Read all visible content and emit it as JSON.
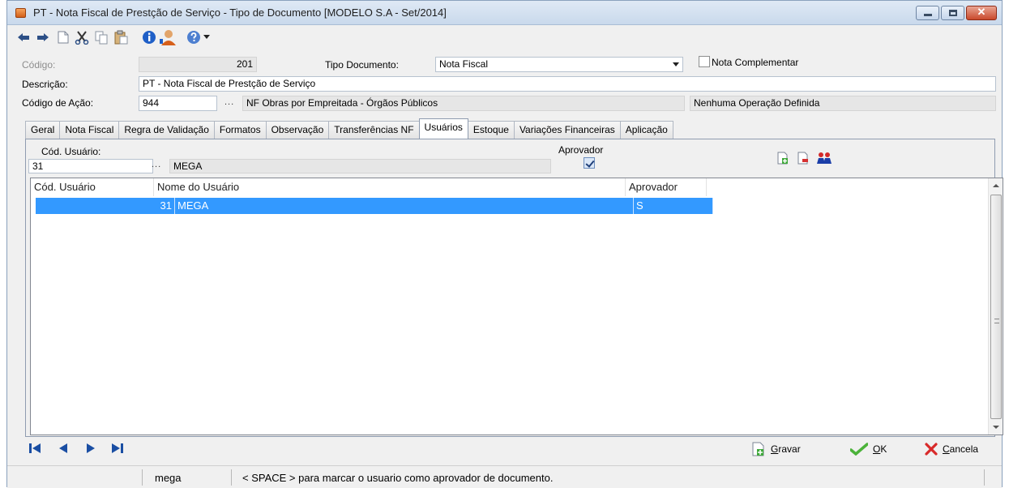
{
  "window": {
    "title": "PT - Nota Fiscal de Prestção de Serviço -  Tipo de Documento [MODELO S.A - Set/2014]",
    "buttons": [
      "minimize",
      "maximize",
      "close"
    ]
  },
  "toolbar": {
    "icons": [
      "undo-icon",
      "redo-icon",
      "new-document-icon",
      "cut-icon",
      "copy-icon",
      "paste-icon",
      "info-icon",
      "user-icon",
      "help-icon",
      "dropdown-arrow-icon"
    ]
  },
  "form": {
    "codigo_label": "Código:",
    "codigo_value": "201",
    "tipo_documento_label": "Tipo Documento:",
    "tipo_documento_value": "Nota Fiscal",
    "nota_complementar_label": "Nota Complementar",
    "nota_complementar_checked": false,
    "descricao_label": "Descrição:",
    "descricao_value": "PT - Nota Fiscal de Prestção de Serviço",
    "codigo_acao_label": "Código de Ação:",
    "codigo_acao_value": "944",
    "lookup_dots": "...",
    "codigo_acao_desc": "NF Obras por Empreitada - Órgãos Públicos",
    "operacao_value": "Nenhuma Operação Definida"
  },
  "tabs": [
    {
      "label": "Geral",
      "active": false
    },
    {
      "label": "Nota Fiscal",
      "active": false
    },
    {
      "label": "Regra de Validação",
      "active": false
    },
    {
      "label": "Formatos",
      "active": false
    },
    {
      "label": "Observação",
      "active": false
    },
    {
      "label": "Transferências NF",
      "active": false
    },
    {
      "label": "Usuários",
      "active": true
    },
    {
      "label": "Estoque",
      "active": false
    },
    {
      "label": "Variações Financeiras",
      "active": false
    },
    {
      "label": "Aplicação",
      "active": false
    }
  ],
  "usuarios": {
    "cod_usuario_label": "Cód. Usuário:",
    "cod_usuario_value": "31",
    "lookup_dots": "...",
    "nome_usuario_value": "MEGA",
    "aprovador_label": "Aprovador",
    "aprovador_checked": true,
    "grid": {
      "columns": [
        "Cód. Usuário",
        "Nome do Usuário",
        "Aprovador"
      ],
      "rows": [
        {
          "cod": "31",
          "nome": "MEGA",
          "aprovador": "S",
          "selected": true
        }
      ]
    }
  },
  "navigation": [
    "first-record-icon",
    "previous-record-icon",
    "next-record-icon",
    "last-record-icon"
  ],
  "actions": {
    "gravar_label": "Gravar",
    "ok_label": "OK",
    "cancela_label": "Cancela"
  },
  "status": {
    "user": "mega",
    "message": "< SPACE > para marcar o usuario como aprovador de documento."
  },
  "colors": {
    "selection": "#3399ff",
    "window_bg": "#f0f0f0",
    "titlebar": "#c9d9ec",
    "nav_arrow": "#1a4ea3"
  }
}
